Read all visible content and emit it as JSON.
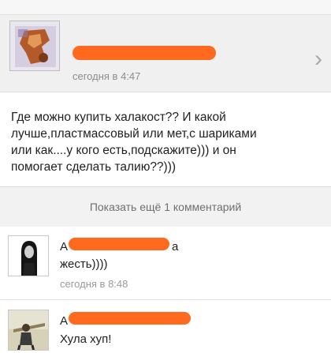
{
  "post": {
    "author_hidden": "",
    "time": "сегодня в 4:47",
    "text": "Где можно купить халакост?? И какой\nлучше,пластмассовый или мет,с шариками\nили как....у кого есть,подскажите))) и он\nпомогает сделать талию??)))",
    "more_comments_label": "Показать ещё 1 комментарий"
  },
  "comments": [
    {
      "author_visible_start": "А",
      "author_visible_end": "а",
      "text": "жесть))))",
      "time": "сегодня в 8:48"
    },
    {
      "author_visible_start": "А",
      "text": "Хула хуп!"
    }
  ],
  "icons": {
    "chevron": "chevron-right-icon"
  },
  "colors": {
    "redaction": "#ff6a1f",
    "header_bg": "#f0f0f0",
    "muted_text": "#8d8d8d"
  }
}
